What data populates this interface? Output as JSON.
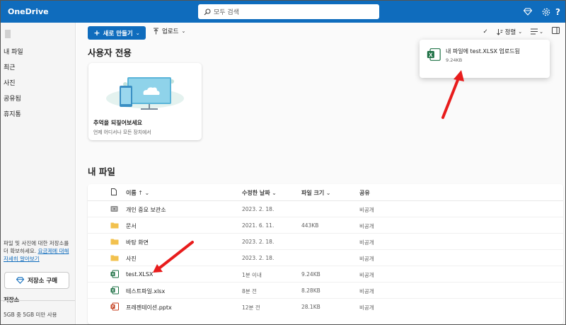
{
  "app": {
    "title": "OneDrive"
  },
  "search": {
    "placeholder": "모두 검색"
  },
  "sidebar": {
    "items": [
      "내 파일",
      "최근",
      "사진",
      "공유됨",
      "휴지통"
    ],
    "note_text": "파일 및 사진에 대한 저장소를 더 확보하세요.",
    "note_link": "요금제에 대해 자세히 알아보기",
    "buy_label": "저장소 구매",
    "storage_title": "저장소",
    "storage_used": "5GB 중 5GB 미만 사용"
  },
  "cmdbar": {
    "new_label": "새로 만들기",
    "upload_label": "업로드",
    "sort_label": "정렬"
  },
  "sections": {
    "personal_title": "사용자 전용",
    "myfiles_title": "내 파일"
  },
  "memories_card": {
    "title": "추억을 되짚어보세요",
    "subtitle": "언제 어디서나 모든 장치에서"
  },
  "columns": {
    "name": "이름",
    "modified": "수정한 날짜",
    "size": "파일 크기",
    "sharing": "공유"
  },
  "files": [
    {
      "name": "개인 중요 보관소",
      "modified": "2023. 2. 18.",
      "size": "",
      "sharing": "비공개",
      "icon": "vault-icon"
    },
    {
      "name": "문서",
      "modified": "2021. 6. 11.",
      "size": "443KB",
      "sharing": "비공개",
      "icon": "folder-icon"
    },
    {
      "name": "바탕 화면",
      "modified": "2023. 2. 18.",
      "size": "",
      "sharing": "비공개",
      "icon": "folder-icon"
    },
    {
      "name": "사진",
      "modified": "2023. 2. 18.",
      "size": "",
      "sharing": "비공개",
      "icon": "folder-icon"
    },
    {
      "name": "test.XLSX",
      "modified": "1분 이내",
      "size": "9.24KB",
      "sharing": "비공개",
      "icon": "excel-icon"
    },
    {
      "name": "테스트파일.xlsx",
      "modified": "8분 전",
      "size": "8.28KB",
      "sharing": "비공개",
      "icon": "excel-icon"
    },
    {
      "name": "프레젠테이션.pptx",
      "modified": "12분 전",
      "size": "28.1KB",
      "sharing": "비공개",
      "icon": "powerpoint-icon"
    }
  ],
  "toast": {
    "title": "내 파일에 test.XLSX 업로드됨",
    "size": "9.24KB"
  },
  "colors": {
    "brand": "#0f6cbd",
    "folder": "#f2c14e",
    "excel": "#1d7044",
    "powerpoint": "#c43e1c",
    "annotation": "#e81c1c"
  }
}
